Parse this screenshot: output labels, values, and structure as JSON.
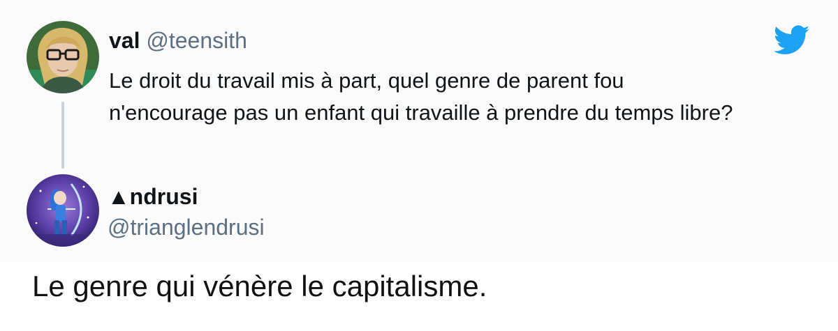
{
  "tweet": {
    "author": {
      "display_name": "val",
      "handle": "@teensith"
    },
    "text": "Le droit du travail mis à part, quel genre de parent fou n'encourage pas un enfant qui travaille à prendre du temps libre?"
  },
  "reply": {
    "author": {
      "display_name": "▲ndrusi",
      "handle": "@trianglendrusi"
    }
  },
  "caption": "Le genre qui vénère le capitalisme.",
  "colors": {
    "twitter_blue": "#1da1f2",
    "handle_gray": "#5b7083",
    "thread_line": "#c7d2da"
  },
  "icons": {
    "brand": "twitter-bird-icon"
  }
}
